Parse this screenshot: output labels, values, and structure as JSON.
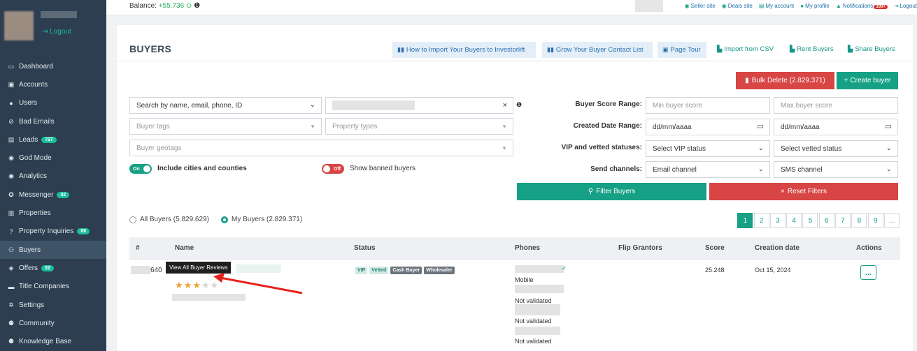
{
  "sidebar": {
    "logout": "Logout",
    "items": [
      {
        "label": "Dashboard",
        "icon": "dashboard-icon"
      },
      {
        "label": "Accounts",
        "icon": "briefcase-icon"
      },
      {
        "label": "Users",
        "icon": "user-icon"
      },
      {
        "label": "Bad Emails",
        "icon": "ban-icon"
      },
      {
        "label": "Leads",
        "icon": "id-card-icon",
        "badge": "727"
      },
      {
        "label": "God Mode",
        "icon": "globe-icon"
      },
      {
        "label": "Analytics",
        "icon": "globe-icon"
      },
      {
        "label": "Messenger",
        "icon": "chat-icon",
        "badge": "42"
      },
      {
        "label": "Properties",
        "icon": "building-icon"
      },
      {
        "label": "Property Inquiries",
        "icon": "question-icon",
        "badge": "86"
      },
      {
        "label": "Buyers",
        "icon": "users-icon"
      },
      {
        "label": "Offers",
        "icon": "handshake-icon",
        "badge": "32"
      },
      {
        "label": "Title Companies",
        "icon": "list-icon"
      },
      {
        "label": "Settings",
        "icon": "gear-icon"
      },
      {
        "label": "Community",
        "icon": "community-icon"
      },
      {
        "label": "Knowledge Base",
        "icon": "book-icon"
      }
    ]
  },
  "topbar": {
    "balance_label": "Balance:",
    "balance_value": "+55.736",
    "links": {
      "seller": "Seller site",
      "deals": "Deals site",
      "account": "My account",
      "profile": "My profile",
      "notifications": "Notifications",
      "notif_badge": "100+",
      "logout": "Logout"
    }
  },
  "header": {
    "title": "BUYERS",
    "how_to_import": "How to Import Your Buyers to Investorlift",
    "grow_list": "Grow Your Buyer Contact List",
    "page_tour": "Page Tour",
    "import_csv": "Import from CSV",
    "rent_buyers": "Rent Buyers",
    "share_buyers": "Share Buyers"
  },
  "actions": {
    "bulk_delete": "Bulk Delete (2.829.371)",
    "create_buyer": "+ Create buyer"
  },
  "filters": {
    "search_by": "Search by name, email, phone, ID",
    "buyer_tags": "Buyer tags",
    "property_types": "Property types",
    "buyer_geotags": "Buyer geotags",
    "include_cities": "Include cities and counties",
    "include_toggle": "On",
    "show_banned": "Show banned buyers",
    "banned_toggle": "Off",
    "score_label": "Buyer Score Range:",
    "min_score": "Min buyer score",
    "max_score": "Max buyer score",
    "date_label": "Created Date Range:",
    "date_from": "dd/mm/aaaa",
    "date_to": "dd/mm/aaaa",
    "vip_label": "VIP and vetted statuses:",
    "vip_select": "Select VIP status",
    "vetted_select": "Select vetted status",
    "channels_label": "Send channels:",
    "email_channel": "Email channel",
    "sms_channel": "SMS channel",
    "filter_btn": "Filter Buyers",
    "reset_btn": "Reset Filters"
  },
  "scope": {
    "all": "All Buyers (5.829.629)",
    "mine": "My Buyers (2.829.371)"
  },
  "pagination": [
    "1",
    "2",
    "3",
    "4",
    "5",
    "6",
    "7",
    "8",
    "9",
    "..."
  ],
  "table": {
    "headers": [
      "#",
      "Name",
      "Status",
      "Phones",
      "Flip Grantors",
      "Score",
      "Creation date",
      "Actions"
    ],
    "row": {
      "id_suffix": "640",
      "tags": [
        "VIP",
        "Vetted",
        "Cash Buyer",
        "Wholesaler"
      ],
      "phone_types": [
        "Mobile",
        "Not validated",
        "Not validated",
        "Not validated"
      ],
      "score": "25.248",
      "created": "Oct 15, 2024",
      "actions": "...",
      "rating": 3.5
    },
    "tooltip": "View All Buyer Reviews"
  },
  "colors": {
    "accent": "#16a085",
    "danger": "#d84545",
    "sidebar": "#2c3e50"
  }
}
